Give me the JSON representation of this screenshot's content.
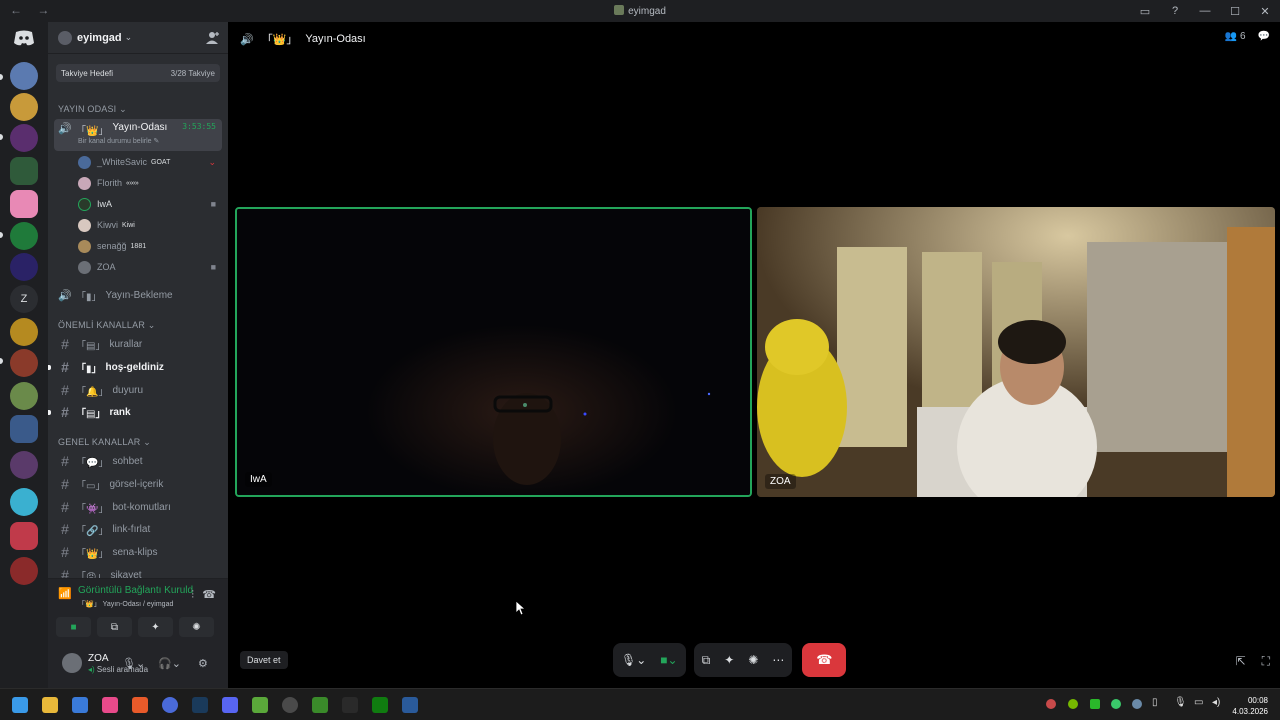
{
  "window": {
    "title": "eyimgad"
  },
  "server": {
    "name": "eyimgad"
  },
  "boost": {
    "label": "Takviye Hedefi",
    "progress": "3/28 Takviye"
  },
  "categories": {
    "yayin": "YAYIN ODASI",
    "onemli": "ÖNEMLİ KANALLAR",
    "genel": "GENEL KANALLAR"
  },
  "voice_channel": {
    "name": "Yayın-Odası",
    "timer": "3:53:55",
    "status_hint": "Bir kanal durumu belirle"
  },
  "members": [
    {
      "name": "_WhiteSavic",
      "tag": "GOAT"
    },
    {
      "name": "Florith",
      "tag": "«∞»"
    },
    {
      "name": "IwA",
      "tag": ""
    },
    {
      "name": "Kiwvi",
      "tag": "Kiwi"
    },
    {
      "name": "senağğ",
      "tag": "1881"
    },
    {
      "name": "ZOA",
      "tag": ""
    }
  ],
  "voice_channel_2": {
    "name": "Yayın-Bekleme"
  },
  "channels_important": [
    {
      "name": "kurallar"
    },
    {
      "name": "hoş-geldiniz"
    },
    {
      "name": "duyuru"
    },
    {
      "name": "rank"
    }
  ],
  "channels_general": [
    {
      "name": "sohbet"
    },
    {
      "name": "görsel-içerik"
    },
    {
      "name": "bot-komutları"
    },
    {
      "name": "link-fırlat"
    },
    {
      "name": "sena-klips"
    },
    {
      "name": "şikayet"
    }
  ],
  "voice_panel": {
    "status": "Görüntülü Bağlantı Kuruld",
    "location": "Yayın-Odası / eyimgad"
  },
  "user_panel": {
    "name": "ZOA",
    "status": "Sesli aramada"
  },
  "stage": {
    "channel_title": "Yayın-Odası",
    "participant_count": "6",
    "invite_label": "Davet et"
  },
  "tiles": [
    {
      "label": "IwA"
    },
    {
      "label": "ZOA"
    }
  ],
  "clock": {
    "time": "00:08",
    "date": "4.03.2026"
  }
}
